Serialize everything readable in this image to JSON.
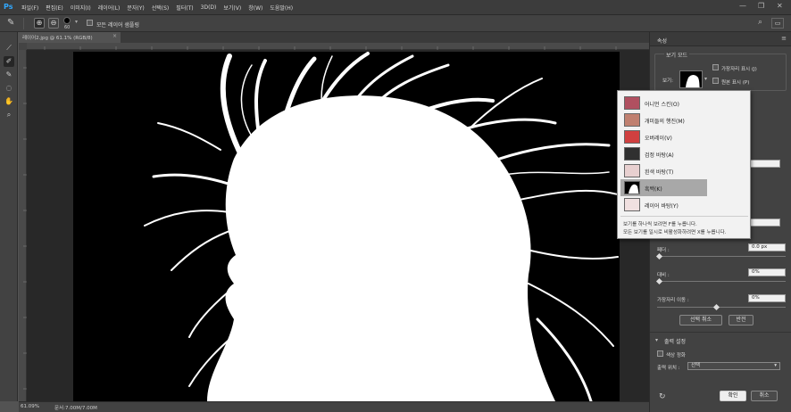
{
  "app": {
    "logo": "Ps"
  },
  "menu": [
    "파일(F)",
    "편집(E)",
    "이미지(I)",
    "레이어(L)",
    "문자(Y)",
    "선택(S)",
    "필터(T)",
    "3D(D)",
    "보기(V)",
    "창(W)",
    "도움말(H)"
  ],
  "window_controls": {
    "minimize": "—",
    "restore": "❐",
    "close": "✕"
  },
  "options": {
    "brush_size": "60",
    "sample_all_layers_label": "모든 레이어 샘플링",
    "mode_add": "⊕",
    "mode_subtract": "⊖"
  },
  "icons": {
    "search": "search-icon",
    "workspace": "workspace-icon",
    "panel_menu": "panel-menu-icon",
    "undo": "rotate-icon"
  },
  "document": {
    "tab_label": "레이어2.jpg @ 61.1% (RGB/8)",
    "tab_close": "×",
    "zoom": "61.09%",
    "doc_info": "문서:7.00M/7.00M"
  },
  "tools": [
    "quick-select-icon",
    "refine-brush-icon",
    "brush-icon",
    "lasso-icon",
    "hand-icon",
    "zoom-icon"
  ],
  "panel": {
    "title": "속성",
    "view_mode": {
      "section_title": "보기 모드",
      "view_label": "보기:",
      "show_edge_label": "가장자리 표시 (J)",
      "show_original_label": "원본 표시 (P)"
    },
    "radius_label": "페더 :",
    "radius_value": "0.0 px",
    "contrast_label": "대비 :",
    "contrast_value": "0%",
    "shift_edge_label": "가장자리 이동 :",
    "shift_edge_value": "0%",
    "clear_selection_label": "선택 취소",
    "invert_label": "반전",
    "output": {
      "section_title": "출력 설정",
      "decontaminate_label": "색상 정화",
      "output_to_label": "출력 위치 :",
      "output_to_value": "선택"
    },
    "ok_label": "확인",
    "cancel_label": "취소"
  },
  "view_dropdown": {
    "items": [
      {
        "label": "어니언 스킨(O)",
        "thumb": "onion"
      },
      {
        "label": "개미들의 행진(M)",
        "thumb": "ants"
      },
      {
        "label": "오버레이(V)",
        "thumb": "overlay"
      },
      {
        "label": "검정 바탕(A)",
        "thumb": "onblack"
      },
      {
        "label": "흰색 바탕(T)",
        "thumb": "onwhite"
      },
      {
        "label": "흑백(K)",
        "thumb": "bw"
      },
      {
        "label": "레이어 바탕(Y)",
        "thumb": "onlayers"
      }
    ],
    "selected_index": 5,
    "hint_1": "보기를 하나씩 보려면 F를 누릅니다.",
    "hint_2": "모든 보기를 일시로 비활성화하려면 X를 누릅니다."
  },
  "colors": {
    "accent": "#31a8ff",
    "panel_bg": "#424242",
    "canvas_bg": "#000000",
    "selection": "#ffffff"
  }
}
